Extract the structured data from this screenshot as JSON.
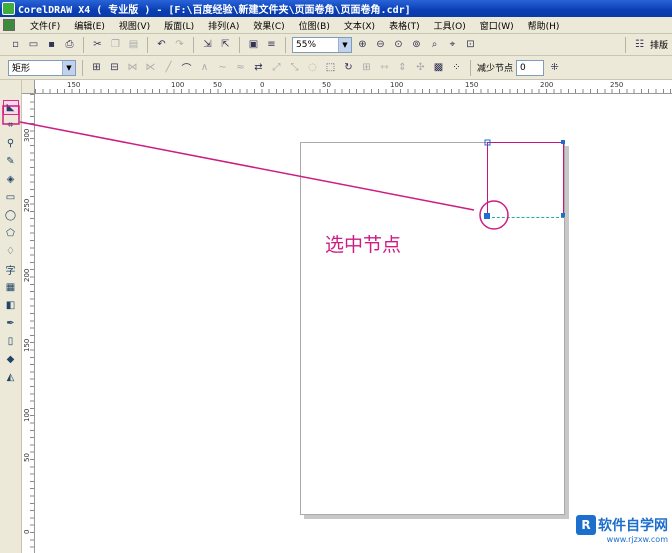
{
  "window": {
    "title": "CorelDRAW X4 ( 专业版 ) - [F:\\百度经验\\新建文件夹\\页面卷角\\页面卷角.cdr]"
  },
  "menu": {
    "items": [
      "文件(F)",
      "编辑(E)",
      "视图(V)",
      "版面(L)",
      "排列(A)",
      "效果(C)",
      "位图(B)",
      "文本(X)",
      "表格(T)",
      "工具(O)",
      "窗口(W)",
      "帮助(H)"
    ]
  },
  "toolbar_std": {
    "zoom_value": "55%",
    "layout_label": "排版"
  },
  "property_bar": {
    "shape_value": "矩形",
    "reduce_nodes_label": "减少节点",
    "node_count_value": "0"
  },
  "ruler_h": {
    "ticks": [
      "150",
      "100",
      "50",
      "0",
      "50",
      "100",
      "150",
      "200",
      "250"
    ]
  },
  "ruler_v": {
    "ticks": [
      "300",
      "250",
      "200",
      "150",
      "100",
      "50",
      "0"
    ]
  },
  "annotation": {
    "text": "选中节点"
  },
  "watermark": {
    "name": "软件自学网",
    "url": "www.rjzxw.com",
    "logo": "R"
  },
  "colors": {
    "annotation": "#cc1d84",
    "title_bar": "#0a3fb4",
    "accent": "#1d6fce"
  }
}
